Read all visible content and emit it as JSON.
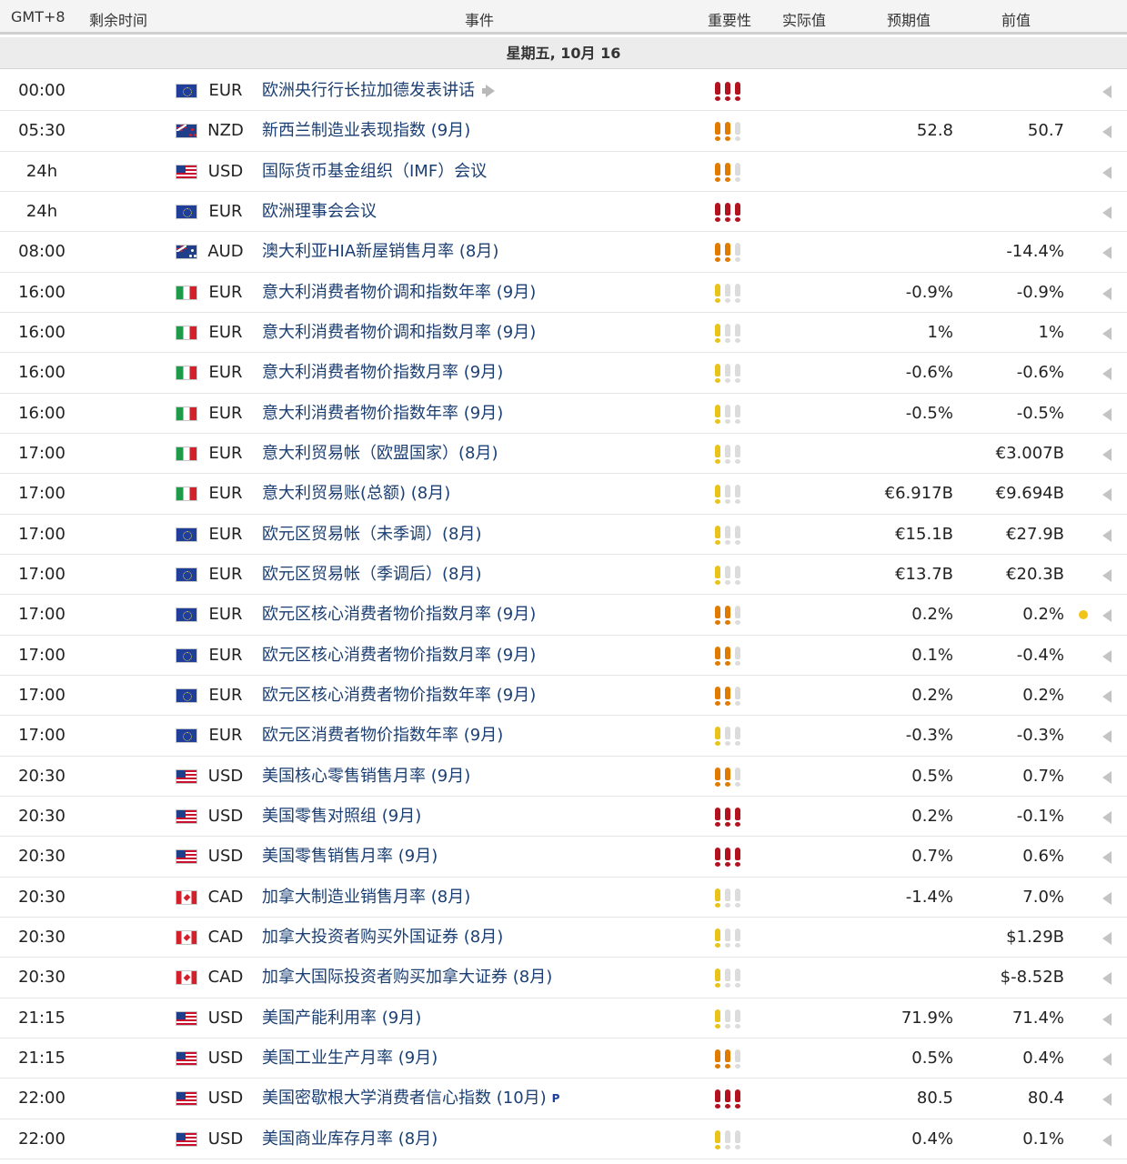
{
  "header": {
    "gmt": "GMT+8",
    "remaining": "剩余时间",
    "event": "事件",
    "importance": "重要性",
    "actual": "实际值",
    "forecast": "预期值",
    "previous": "前值"
  },
  "day": "星期五, 10月 16",
  "importance_colors": {
    "high": "#b3121f",
    "medium": "#e07b00",
    "low": "#e8c41a",
    "off": "#dcdcdc"
  },
  "rows": [
    {
      "time": "00:00",
      "flag": "eu",
      "currency": "EUR",
      "event": "欧洲央行行长拉加德发表讲话",
      "importance": 3,
      "actual": "",
      "forecast": "",
      "previous": "",
      "speech": true
    },
    {
      "time": "05:30",
      "flag": "nz",
      "currency": "NZD",
      "event": "新西兰制造业表现指数 (9月)",
      "importance": 2,
      "actual": "",
      "forecast": "52.8",
      "previous": "50.7"
    },
    {
      "time": "24h",
      "flag": "us",
      "currency": "USD",
      "event": "国际货币基金组织（IMF）会议",
      "importance": 2,
      "actual": "",
      "forecast": "",
      "previous": ""
    },
    {
      "time": "24h",
      "flag": "eu",
      "currency": "EUR",
      "event": "欧洲理事会会议",
      "importance": 3,
      "actual": "",
      "forecast": "",
      "previous": ""
    },
    {
      "time": "08:00",
      "flag": "au",
      "currency": "AUD",
      "event": "澳大利亚HIA新屋销售月率 (8月)",
      "importance": 2,
      "actual": "",
      "forecast": "",
      "previous": "-14.4%"
    },
    {
      "time": "16:00",
      "flag": "it",
      "currency": "EUR",
      "event": "意大利消费者物价调和指数年率 (9月)",
      "importance": 1,
      "actual": "",
      "forecast": "-0.9%",
      "previous": "-0.9%"
    },
    {
      "time": "16:00",
      "flag": "it",
      "currency": "EUR",
      "event": "意大利消费者物价调和指数月率 (9月)",
      "importance": 1,
      "actual": "",
      "forecast": "1%",
      "previous": "1%"
    },
    {
      "time": "16:00",
      "flag": "it",
      "currency": "EUR",
      "event": "意大利消费者物价指数月率 (9月)",
      "importance": 1,
      "actual": "",
      "forecast": "-0.6%",
      "previous": "-0.6%"
    },
    {
      "time": "16:00",
      "flag": "it",
      "currency": "EUR",
      "event": "意大利消费者物价指数年率 (9月)",
      "importance": 1,
      "actual": "",
      "forecast": "-0.5%",
      "previous": "-0.5%"
    },
    {
      "time": "17:00",
      "flag": "it",
      "currency": "EUR",
      "event": "意大利贸易帐（欧盟国家）(8月)",
      "importance": 1,
      "actual": "",
      "forecast": "",
      "previous": "€3.007B"
    },
    {
      "time": "17:00",
      "flag": "it",
      "currency": "EUR",
      "event": "意大利贸易账(总额) (8月)",
      "importance": 1,
      "actual": "",
      "forecast": "€6.917B",
      "previous": "€9.694B"
    },
    {
      "time": "17:00",
      "flag": "eu",
      "currency": "EUR",
      "event": "欧元区贸易帐（未季调）(8月)",
      "importance": 1,
      "actual": "",
      "forecast": "€15.1B",
      "previous": "€27.9B"
    },
    {
      "time": "17:00",
      "flag": "eu",
      "currency": "EUR",
      "event": "欧元区贸易帐（季调后）(8月)",
      "importance": 1,
      "actual": "",
      "forecast": "€13.7B",
      "previous": "€20.3B"
    },
    {
      "time": "17:00",
      "flag": "eu",
      "currency": "EUR",
      "event": "欧元区核心消费者物价指数月率 (9月)",
      "importance": 2,
      "actual": "",
      "forecast": "0.2%",
      "previous": "0.2%",
      "dot": true
    },
    {
      "time": "17:00",
      "flag": "eu",
      "currency": "EUR",
      "event": "欧元区核心消费者物价指数月率 (9月)",
      "importance": 2,
      "actual": "",
      "forecast": "0.1%",
      "previous": "-0.4%"
    },
    {
      "time": "17:00",
      "flag": "eu",
      "currency": "EUR",
      "event": "欧元区核心消费者物价指数年率 (9月)",
      "importance": 2,
      "actual": "",
      "forecast": "0.2%",
      "previous": "0.2%"
    },
    {
      "time": "17:00",
      "flag": "eu",
      "currency": "EUR",
      "event": "欧元区消费者物价指数年率 (9月)",
      "importance": 1,
      "actual": "",
      "forecast": "-0.3%",
      "previous": "-0.3%"
    },
    {
      "time": "20:30",
      "flag": "us",
      "currency": "USD",
      "event": "美国核心零售销售月率 (9月)",
      "importance": 2,
      "actual": "",
      "forecast": "0.5%",
      "previous": "0.7%"
    },
    {
      "time": "20:30",
      "flag": "us",
      "currency": "USD",
      "event": "美国零售对照组 (9月)",
      "importance": 3,
      "actual": "",
      "forecast": "0.2%",
      "previous": "-0.1%"
    },
    {
      "time": "20:30",
      "flag": "us",
      "currency": "USD",
      "event": "美国零售销售月率 (9月)",
      "importance": 3,
      "actual": "",
      "forecast": "0.7%",
      "previous": "0.6%"
    },
    {
      "time": "20:30",
      "flag": "ca",
      "currency": "CAD",
      "event": "加拿大制造业销售月率 (8月)",
      "importance": 1,
      "actual": "",
      "forecast": "-1.4%",
      "previous": "7.0%"
    },
    {
      "time": "20:30",
      "flag": "ca",
      "currency": "CAD",
      "event": "加拿大投资者购买外国证券 (8月)",
      "importance": 1,
      "actual": "",
      "forecast": "",
      "previous": "$1.29B"
    },
    {
      "time": "20:30",
      "flag": "ca",
      "currency": "CAD",
      "event": "加拿大国际投资者购买加拿大证券 (8月)",
      "importance": 1,
      "actual": "",
      "forecast": "",
      "previous": "$-8.52B"
    },
    {
      "time": "21:15",
      "flag": "us",
      "currency": "USD",
      "event": "美国产能利用率 (9月)",
      "importance": 1,
      "actual": "",
      "forecast": "71.9%",
      "previous": "71.4%"
    },
    {
      "time": "21:15",
      "flag": "us",
      "currency": "USD",
      "event": "美国工业生产月率 (9月)",
      "importance": 2,
      "actual": "",
      "forecast": "0.5%",
      "previous": "0.4%"
    },
    {
      "time": "22:00",
      "flag": "us",
      "currency": "USD",
      "event": "美国密歇根大学消费者信心指数 (10月)",
      "importance": 3,
      "actual": "",
      "forecast": "80.5",
      "previous": "80.4",
      "preliminary": "P"
    },
    {
      "time": "22:00",
      "flag": "us",
      "currency": "USD",
      "event": "美国商业库存月率 (8月)",
      "importance": 1,
      "actual": "",
      "forecast": "0.4%",
      "previous": "0.1%"
    }
  ]
}
